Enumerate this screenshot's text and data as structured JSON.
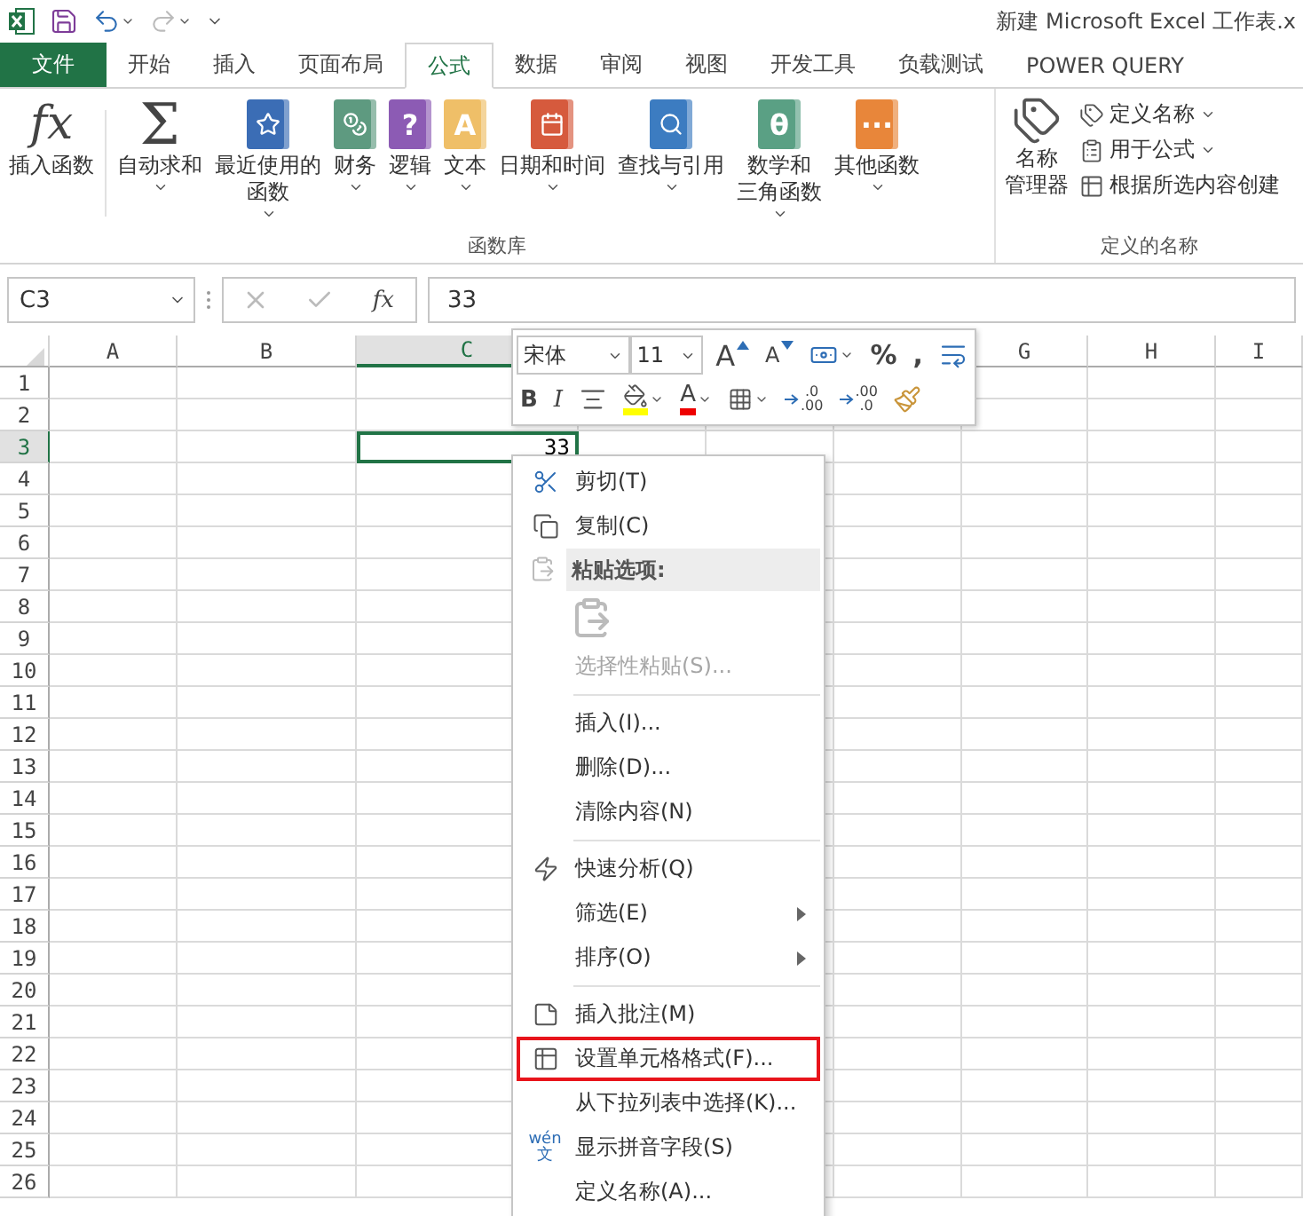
{
  "window": {
    "title": "新建 Microsoft Excel 工作表.x"
  },
  "tabs": [
    {
      "label": "文件",
      "kind": "file",
      "selected": false
    },
    {
      "label": "开始",
      "kind": "tab",
      "selected": false
    },
    {
      "label": "插入",
      "kind": "tab",
      "selected": false
    },
    {
      "label": "页面布局",
      "kind": "tab",
      "selected": false
    },
    {
      "label": "公式",
      "kind": "tab",
      "selected": true
    },
    {
      "label": "数据",
      "kind": "tab",
      "selected": false
    },
    {
      "label": "审阅",
      "kind": "tab",
      "selected": false
    },
    {
      "label": "视图",
      "kind": "tab",
      "selected": false
    },
    {
      "label": "开发工具",
      "kind": "tab",
      "selected": false
    },
    {
      "label": "负载测试",
      "kind": "tab",
      "selected": false
    },
    {
      "label": "POWER QUERY",
      "kind": "tab",
      "selected": false
    }
  ],
  "ribbon": {
    "groups": [
      {
        "label": "函数库",
        "buttons": [
          {
            "label": "插入函数",
            "kind": "glyph",
            "glyph": "fx",
            "menu": false
          },
          {
            "label": "自动求和",
            "kind": "glyph",
            "glyph": "Σ",
            "menu": true
          },
          {
            "label": [
              "最近使用的",
              "函数"
            ],
            "kind": "book",
            "color": "#3b6db5",
            "menu": true
          },
          {
            "label": "财务",
            "kind": "book",
            "color": "#5e9a80",
            "menu": true
          },
          {
            "label": "逻辑",
            "kind": "book",
            "color": "#8c5bb4",
            "glyph": "?",
            "menu": true
          },
          {
            "label": "文本",
            "kind": "book",
            "color": "#efbf68",
            "glyph": "A",
            "menu": true
          },
          {
            "label": "日期和时间",
            "kind": "book",
            "color": "#d65a3d",
            "menu": true
          },
          {
            "label": "查找与引用",
            "kind": "book",
            "color": "#3c7cc1",
            "menu": true
          },
          {
            "label": [
              "数学和",
              "三角函数"
            ],
            "kind": "book",
            "color": "#5aa084",
            "glyph": "θ",
            "menu": true
          },
          {
            "label": "其他函数",
            "kind": "book",
            "color": "#e8863a",
            "glyph": "···",
            "menu": true
          }
        ]
      },
      {
        "label": "定义的名称",
        "big": {
          "label": [
            "名称",
            "管理器"
          ]
        },
        "small": [
          {
            "label": "定义名称",
            "menu": true
          },
          {
            "label": "用于公式",
            "menu": true
          },
          {
            "label": "根据所选内容创建",
            "menu": false
          }
        ]
      }
    ]
  },
  "formula_bar": {
    "name_box": "C3",
    "fx": "fx",
    "value": "33"
  },
  "sheet": {
    "columns": [
      {
        "label": "A",
        "selected": false
      },
      {
        "label": "B",
        "selected": false
      },
      {
        "label": "C",
        "selected": true
      },
      {
        "label": "G",
        "selected": false
      },
      {
        "label": "H",
        "selected": false
      },
      {
        "label": "I",
        "selected": false
      }
    ],
    "rows": [
      {
        "label": "1",
        "selected": false
      },
      {
        "label": "2",
        "selected": false
      },
      {
        "label": "3",
        "selected": true
      },
      {
        "label": "4",
        "selected": false
      },
      {
        "label": "5",
        "selected": false
      },
      {
        "label": "6",
        "selected": false
      },
      {
        "label": "7",
        "selected": false
      },
      {
        "label": "8",
        "selected": false
      },
      {
        "label": "9",
        "selected": false
      },
      {
        "label": "10",
        "selected": false
      },
      {
        "label": "11",
        "selected": false
      },
      {
        "label": "12",
        "selected": false
      },
      {
        "label": "13",
        "selected": false
      },
      {
        "label": "14",
        "selected": false
      },
      {
        "label": "15",
        "selected": false
      },
      {
        "label": "16",
        "selected": false
      },
      {
        "label": "17",
        "selected": false
      },
      {
        "label": "18",
        "selected": false
      },
      {
        "label": "19",
        "selected": false
      },
      {
        "label": "20",
        "selected": false
      },
      {
        "label": "21",
        "selected": false
      },
      {
        "label": "22",
        "selected": false
      },
      {
        "label": "23",
        "selected": false
      },
      {
        "label": "24",
        "selected": false
      },
      {
        "label": "25",
        "selected": false
      },
      {
        "label": "26",
        "selected": false
      }
    ],
    "active_cell": {
      "value": "33"
    }
  },
  "mini_toolbar": {
    "font": "宋体",
    "size": "11",
    "row1": [
      {
        "kind": "grow",
        "text": "A"
      },
      {
        "kind": "shrink",
        "text": "A"
      },
      {
        "kind": "accounting",
        "menu": true
      },
      {
        "kind": "char",
        "text": "%"
      },
      {
        "kind": "char",
        "text": ","
      },
      {
        "kind": "wrap"
      }
    ],
    "row2": [
      {
        "kind": "bold",
        "text": "B"
      },
      {
        "kind": "italic",
        "text": "I"
      },
      {
        "kind": "align"
      },
      {
        "kind": "fill",
        "menu": true
      },
      {
        "kind": "fontcolor",
        "text": "A",
        "menu": true
      },
      {
        "kind": "borders",
        "menu": true
      },
      {
        "kind": "decimal",
        "text": ".0",
        "text2": ".00"
      },
      {
        "kind": "decimal",
        "text": ".00",
        "text2": ".0"
      },
      {
        "kind": "painter"
      }
    ]
  },
  "context_menu": [
    {
      "kind": "item",
      "label": "剪切(T)",
      "disabled": false,
      "submenu": false,
      "outlined": false
    },
    {
      "kind": "item",
      "label": "复制(C)",
      "disabled": false,
      "submenu": false,
      "outlined": false
    },
    {
      "kind": "header",
      "label": "粘贴选项:"
    },
    {
      "kind": "paste"
    },
    {
      "kind": "item",
      "label": "选择性粘贴(S)...",
      "disabled": true,
      "submenu": false,
      "outlined": false
    },
    {
      "kind": "separator"
    },
    {
      "kind": "item",
      "label": "插入(I)...",
      "disabled": false,
      "submenu": false,
      "outlined": false
    },
    {
      "kind": "item",
      "label": "删除(D)...",
      "disabled": false,
      "submenu": false,
      "outlined": false
    },
    {
      "kind": "item",
      "label": "清除内容(N)",
      "disabled": false,
      "submenu": false,
      "outlined": false
    },
    {
      "kind": "separator"
    },
    {
      "kind": "item",
      "label": "快速分析(Q)",
      "disabled": false,
      "submenu": false,
      "outlined": false
    },
    {
      "kind": "item",
      "label": "筛选(E)",
      "disabled": false,
      "submenu": true,
      "outlined": false
    },
    {
      "kind": "item",
      "label": "排序(O)",
      "disabled": false,
      "submenu": true,
      "outlined": false
    },
    {
      "kind": "separator"
    },
    {
      "kind": "item",
      "label": "插入批注(M)",
      "disabled": false,
      "submenu": false,
      "outlined": false
    },
    {
      "kind": "item",
      "label": "设置单元格格式(F)...",
      "disabled": false,
      "submenu": false,
      "outlined": true
    },
    {
      "kind": "item",
      "label": "从下拉列表中选择(K)...",
      "disabled": false,
      "submenu": false,
      "outlined": false
    },
    {
      "kind": "item",
      "label": "显示拼音字段(S)",
      "disabled": false,
      "submenu": false,
      "outlined": false,
      "icon_text": [
        "wén",
        "文"
      ]
    },
    {
      "kind": "item",
      "label": "定义名称(A)...",
      "disabled": false,
      "submenu": false,
      "outlined": false
    }
  ]
}
